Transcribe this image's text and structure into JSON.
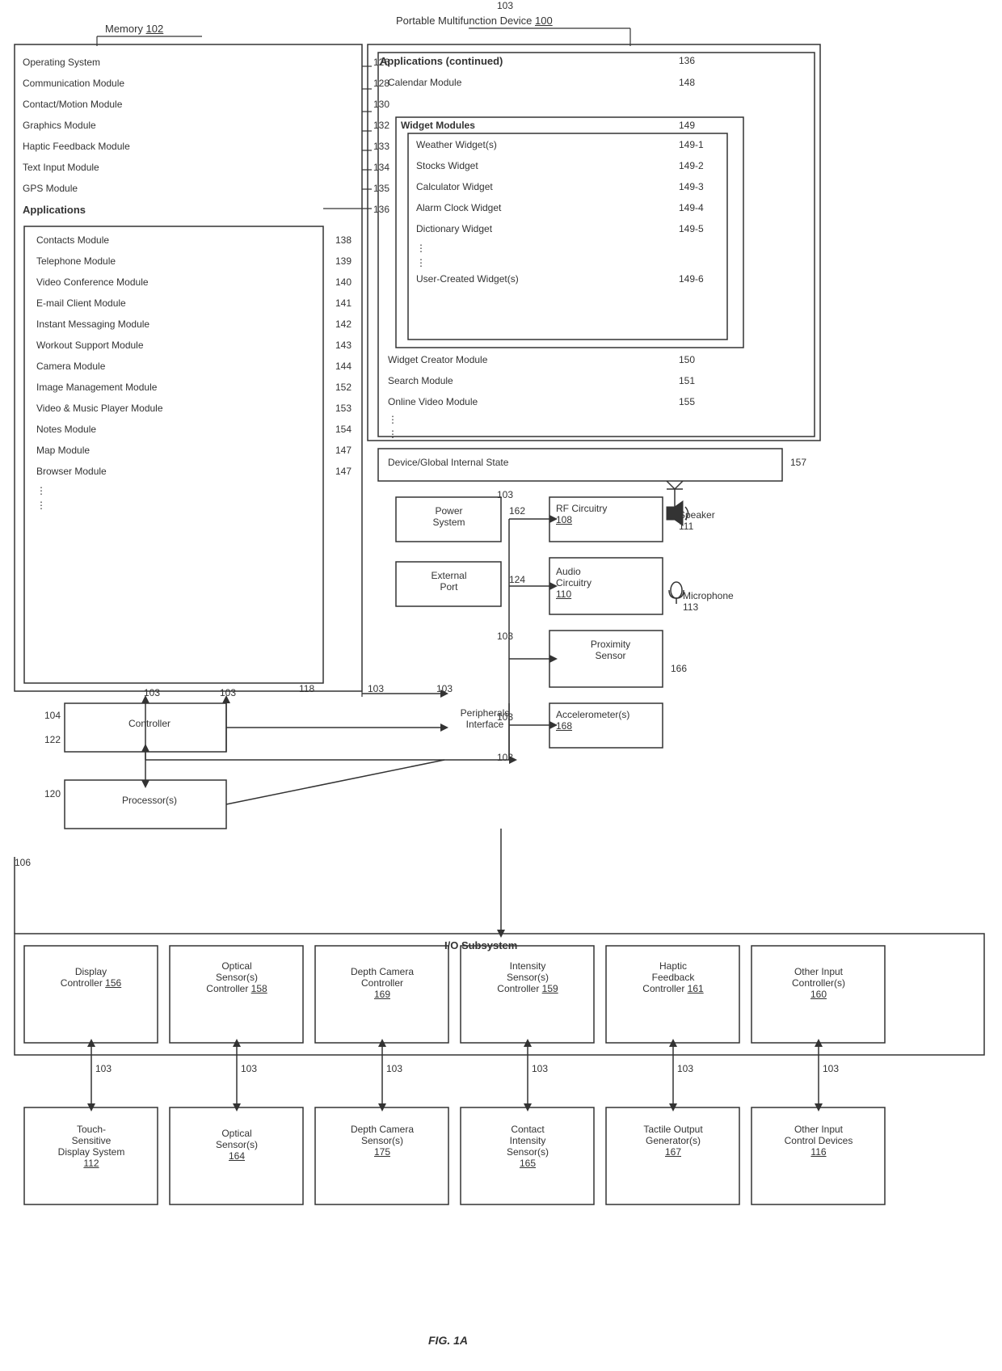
{
  "title": "FIG. 1A",
  "memory_label": "Memory",
  "memory_ref": "102",
  "device_label": "Portable Multifunction Device",
  "device_ref": "100",
  "memory_items": [
    {
      "text": "Operating System",
      "ref": "126"
    },
    {
      "text": "Communication Module",
      "ref": "128"
    },
    {
      "text": "Contact/Motion Module",
      "ref": "130"
    },
    {
      "text": "Graphics Module",
      "ref": "132"
    },
    {
      "text": "Haptic Feedback Module",
      "ref": "133"
    },
    {
      "text": "Text Input Module",
      "ref": "134"
    },
    {
      "text": "GPS Module",
      "ref": "135"
    },
    {
      "text": "Applications",
      "ref": "136"
    },
    {
      "text": "Contacts Module",
      "ref": "138"
    },
    {
      "text": "Telephone Module",
      "ref": "139"
    },
    {
      "text": "Video Conference Module",
      "ref": "140"
    },
    {
      "text": "E-mail Client Module",
      "ref": "141"
    },
    {
      "text": "Instant Messaging Module",
      "ref": "142"
    },
    {
      "text": "Workout Support Module",
      "ref": "143"
    },
    {
      "text": "Camera Module",
      "ref": "144"
    },
    {
      "text": "Image Management Module",
      "ref": "152"
    },
    {
      "text": "Video & Music Player Module",
      "ref": "153"
    },
    {
      "text": "Notes Module",
      "ref": "154"
    },
    {
      "text": "Map Module",
      "ref": "147"
    },
    {
      "text": "Browser Module",
      "ref": "147"
    }
  ],
  "app_items": [
    {
      "text": "Applications (continued)",
      "ref": "136"
    },
    {
      "text": "Calendar Module",
      "ref": "148"
    },
    {
      "text": "Widget Modules",
      "ref": "149"
    },
    {
      "text": "Weather Widget(s)",
      "ref": "149-1"
    },
    {
      "text": "Stocks Widget",
      "ref": "149-2"
    },
    {
      "text": "Calculator Widget",
      "ref": "149-3"
    },
    {
      "text": "Alarm Clock Widget",
      "ref": "149-4"
    },
    {
      "text": "Dictionary Widget",
      "ref": "149-5"
    },
    {
      "text": "User-Created Widget(s)",
      "ref": "149-6"
    },
    {
      "text": "Widget Creator Module",
      "ref": "150"
    },
    {
      "text": "Search Module",
      "ref": "151"
    },
    {
      "text": "Online Video Module",
      "ref": "155"
    }
  ],
  "device_global": "Device/Global Internal State",
  "device_global_ref": "157",
  "power_system": "Power System",
  "power_ref": "162",
  "external_port": "External Port",
  "external_ref": "124",
  "rf_circuitry": "RF Circuitry",
  "rf_ref": "108",
  "speaker": "Speaker",
  "speaker_ref": "111",
  "audio_circuitry": "Audio Circuitry",
  "audio_ref": "110",
  "microphone": "Microphone",
  "mic_ref": "113",
  "proximity_sensor": "Proximity Sensor",
  "proximity_ref": "166",
  "accelerometer": "Accelerometer(s)",
  "accel_ref": "168",
  "peripherals_interface": "Peripherals Interface",
  "controller": "Controller",
  "controller_ref": "104",
  "processor": "Processor(s)",
  "processor_ref": "120",
  "bus_ref": "103",
  "io_subsystem": "I/O Subsystem",
  "io_ref": "106",
  "io_items": [
    {
      "text": "Display Controller",
      "ref": "156"
    },
    {
      "text": "Optical Sensor(s) Controller",
      "ref": "158"
    },
    {
      "text": "Depth Camera Controller",
      "ref": "169"
    },
    {
      "text": "Intensity Sensor(s) Controller",
      "ref": "159"
    },
    {
      "text": "Haptic Feedback Controller",
      "ref": "161"
    },
    {
      "text": "Other Input Controller(s)",
      "ref": "160"
    }
  ],
  "sensor_items": [
    {
      "text": "Touch-Sensitive Display System",
      "ref": "112"
    },
    {
      "text": "Optical Sensor(s)",
      "ref": "164"
    },
    {
      "text": "Depth Camera Sensor(s)",
      "ref": "175"
    },
    {
      "text": "Contact Intensity Sensor(s)",
      "ref": "165"
    },
    {
      "text": "Tactile Output Generator(s)",
      "ref": "167"
    },
    {
      "text": "Other Input Control Devices",
      "ref": "116"
    }
  ]
}
